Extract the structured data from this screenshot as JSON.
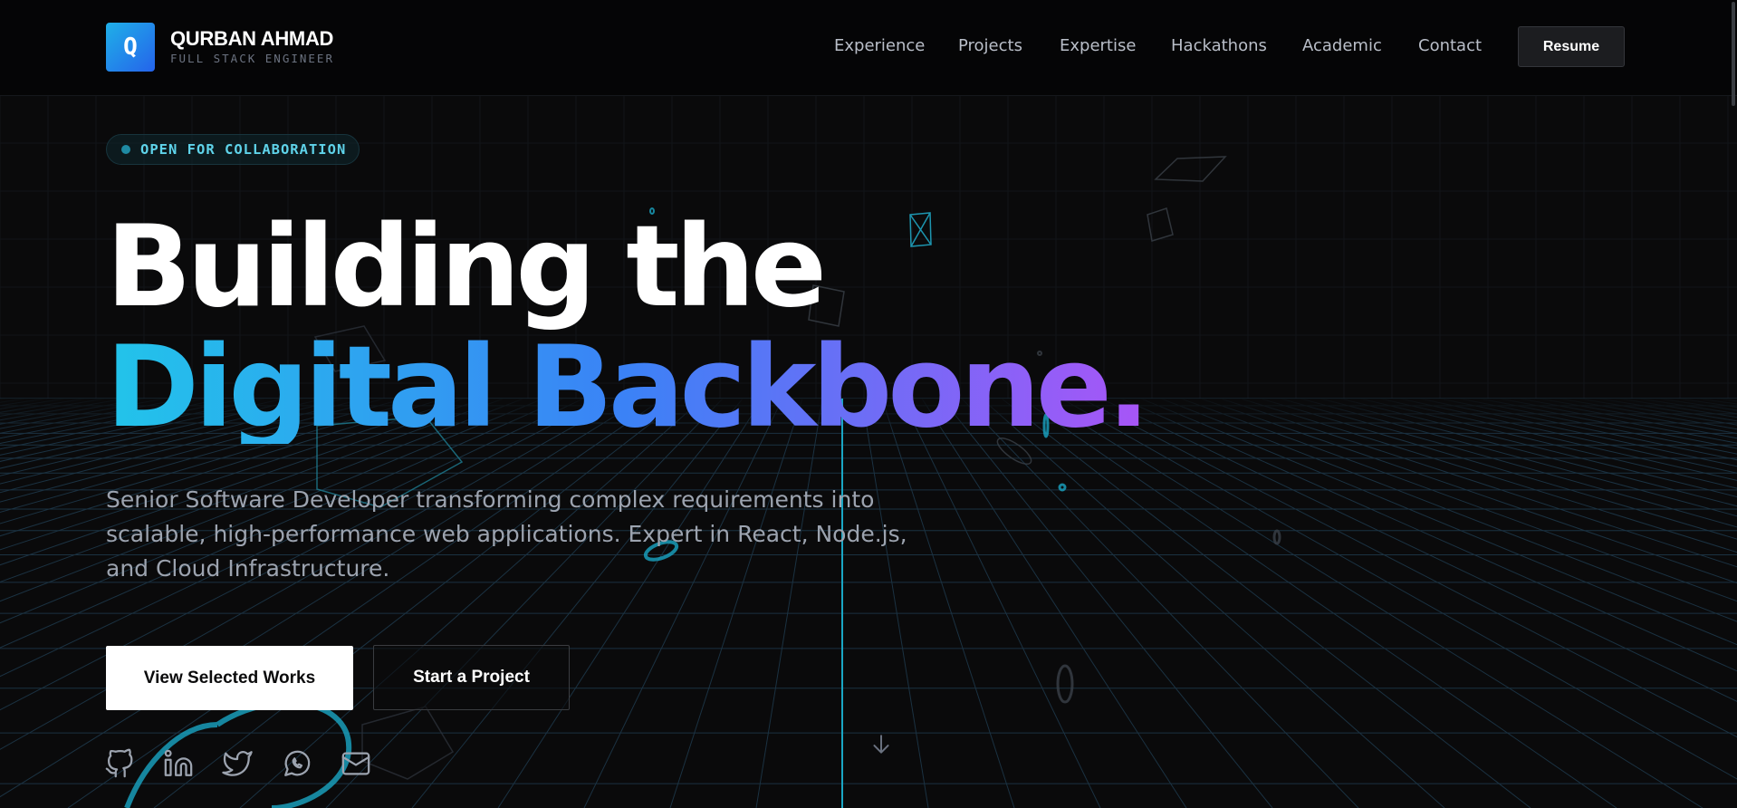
{
  "brand": {
    "logo_letter": "Q",
    "name": "QURBAN AHMAD",
    "tagline": "FULL STACK ENGINEER"
  },
  "nav": {
    "items": [
      {
        "label": "Experience"
      },
      {
        "label": "Projects"
      },
      {
        "label": "Expertise"
      },
      {
        "label": "Hackathons"
      },
      {
        "label": "Academic"
      },
      {
        "label": "Contact"
      }
    ],
    "resume_label": "Resume"
  },
  "hero": {
    "badge": "OPEN FOR COLLABORATION",
    "headline_line1": "Building the",
    "headline_line2": "Digital Backbone.",
    "subtitle": "Senior Software Developer transforming complex requirements into scalable, high-performance web applications. Expert in React, Node.js, and Cloud Infrastructure.",
    "primary_cta": "View Selected Works",
    "secondary_cta": "Start a Project"
  },
  "social": {
    "icons": [
      "github-icon",
      "linkedin-icon",
      "twitter-icon",
      "whatsapp-icon",
      "mail-icon"
    ]
  },
  "colors": {
    "background": "#0a0a0b",
    "accent_cyan": "#22c4ea",
    "accent_blue": "#3b82f6",
    "accent_purple": "#a855f7",
    "grid_line": "#1e3a4f"
  }
}
